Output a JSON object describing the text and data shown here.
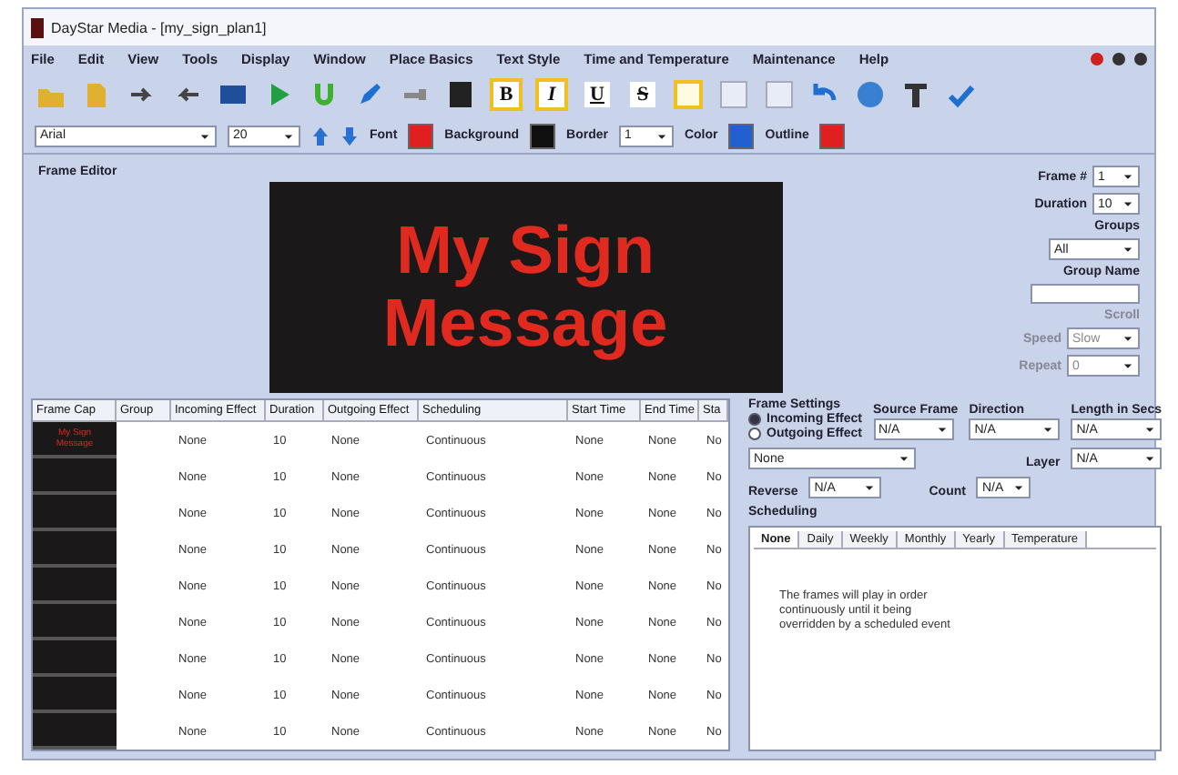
{
  "window": {
    "title": "DayStar Media - [my_sign_plan1]"
  },
  "menu": [
    "File",
    "Edit",
    "View",
    "Tools",
    "Display",
    "Window",
    "Place Basics",
    "Text Style",
    "Time and Temperature",
    "Maintenance",
    "Help"
  ],
  "style_buttons": [
    {
      "label": "B",
      "selected": true
    },
    {
      "label": "I",
      "selected": true
    },
    {
      "label": "U",
      "selected": false
    },
    {
      "label": "S",
      "selected": false
    }
  ],
  "format_bar": {
    "font": "Arial",
    "size": "20",
    "swatches": [
      {
        "label": "Font",
        "color": "#e02020"
      },
      {
        "label": "Background",
        "color": "#101010"
      }
    ],
    "border_label": "Border",
    "border": "1",
    "swatches_2": [
      {
        "label": "Color",
        "color": "#2060d0"
      },
      {
        "label": "Outline",
        "color": "#e02020"
      }
    ]
  },
  "frame_editor": {
    "title": "Frame Editor",
    "sign_lines": [
      "My Sign",
      "Message"
    ],
    "frame_label": "Frame #",
    "frame": "1",
    "duration_label": "Duration",
    "duration": "10",
    "groups_label": "Groups",
    "group": "All",
    "group_name_label": "Group Name",
    "scroll_label": "Scroll",
    "speed_label": "Speed",
    "speed": "Slow",
    "repeat_label": "Repeat",
    "repeat": "0"
  },
  "table": {
    "columns": [
      "Frame Cap",
      "Group",
      "Incoming Effect",
      "Duration",
      "Outgoing Effect",
      "Scheduling",
      "Start Time",
      "End Time",
      "Sta"
    ],
    "rows": [
      {
        "cells": [
          "My Sign Message",
          "",
          "None",
          "10",
          "None",
          "Continuous",
          "None",
          "None",
          "No"
        ]
      },
      {
        "cells": [
          "",
          "",
          "None",
          "10",
          "None",
          "Continuous",
          "None",
          "None",
          "No"
        ]
      },
      {
        "cells": [
          "",
          "",
          "None",
          "10",
          "None",
          "Continuous",
          "None",
          "None",
          "No"
        ]
      },
      {
        "cells": [
          "",
          "",
          "None",
          "10",
          "None",
          "Continuous",
          "None",
          "None",
          "No"
        ]
      },
      {
        "cells": [
          "",
          "",
          "None",
          "10",
          "None",
          "Continuous",
          "None",
          "None",
          "No"
        ]
      },
      {
        "cells": [
          "",
          "",
          "None",
          "10",
          "None",
          "Continuous",
          "None",
          "None",
          "No"
        ]
      },
      {
        "cells": [
          "",
          "",
          "None",
          "10",
          "None",
          "Continuous",
          "None",
          "None",
          "No"
        ]
      },
      {
        "cells": [
          "",
          "",
          "None",
          "10",
          "None",
          "Continuous",
          "None",
          "None",
          "No"
        ]
      },
      {
        "cells": [
          "",
          "",
          "None",
          "10",
          "None",
          "Continuous",
          "None",
          "None",
          "No"
        ]
      }
    ]
  },
  "frame_settings": {
    "title": "Frame Settings",
    "effects": [
      {
        "label": "Incoming Effect",
        "selected": true
      },
      {
        "label": "Outgoing Effect",
        "selected": false
      }
    ],
    "source_label": "Source Frame",
    "source": "N/A",
    "direction_label": "Direction",
    "direction": "N/A",
    "length_label": "Length in Secs",
    "length": "N/A",
    "effect": "None",
    "layer_label": "Layer",
    "layer": "N/A",
    "reverse_label": "Reverse",
    "reverse": "N/A",
    "count_label": "Count",
    "count": "N/A"
  },
  "scheduling": {
    "title": "Scheduling",
    "tabs": [
      {
        "label": "None",
        "selected": true
      },
      {
        "label": "Daily",
        "selected": false
      },
      {
        "label": "Weekly",
        "selected": false
      },
      {
        "label": "Monthly",
        "selected": false
      },
      {
        "label": "Yearly",
        "selected": false
      },
      {
        "label": "Temperature",
        "selected": false
      }
    ],
    "lines": [
      "The frames will play in order",
      "continuously until it being",
      "overridden by a scheduled event"
    ]
  }
}
